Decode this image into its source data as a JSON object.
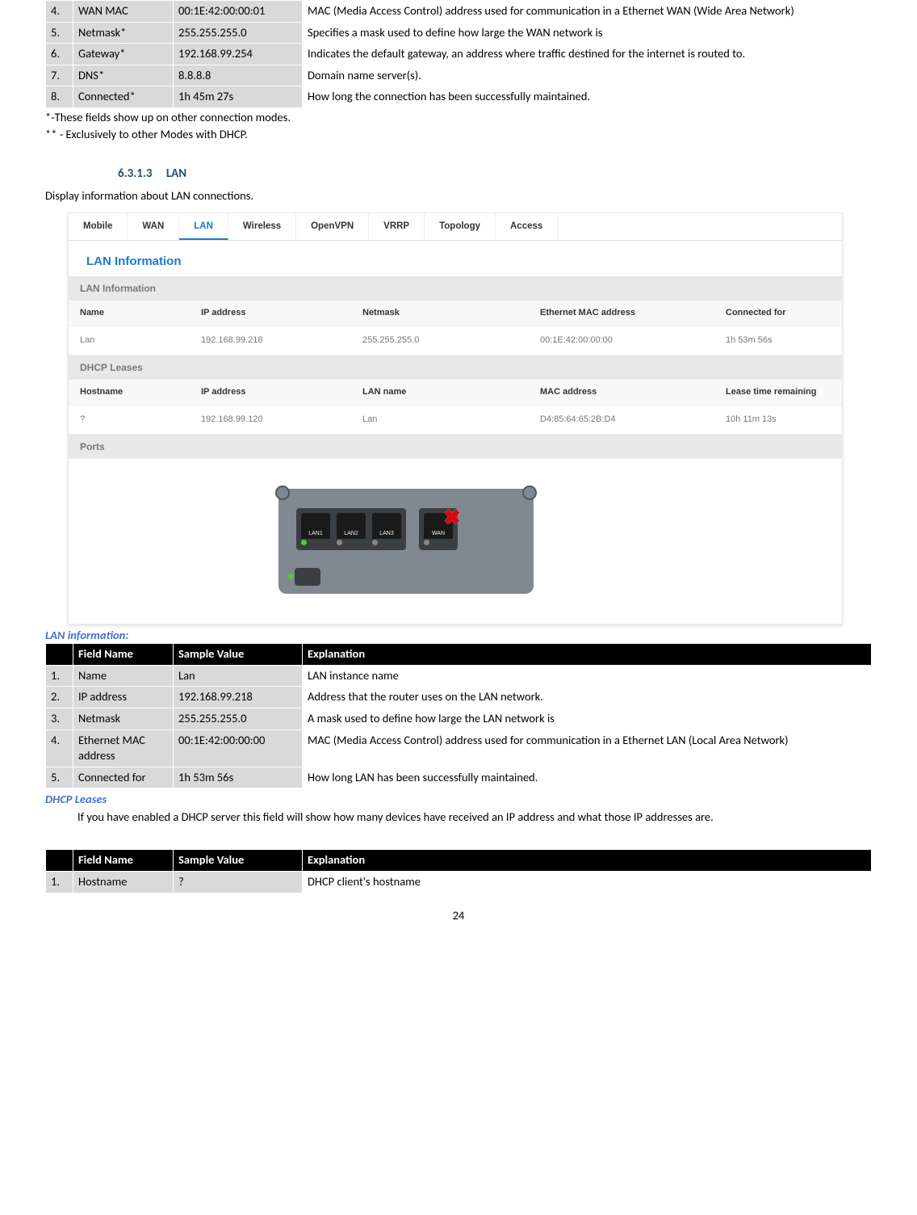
{
  "top_table": {
    "rows": [
      {
        "n": "4.",
        "field": "WAN MAC",
        "sample": "00:1E:42:00:00:01",
        "expl": "MAC (Media Access Control) address used for communication in a Ethernet WAN (Wide Area Network)"
      },
      {
        "n": "5.",
        "field": "Netmask*",
        "sample": "255.255.255.0",
        "expl": "Specifies a mask used to define how large the WAN network is"
      },
      {
        "n": "6.",
        "field": "Gateway*",
        "sample": "192.168.99.254",
        "expl": "Indicates the default gateway, an address where traffic destined for the internet is routed to."
      },
      {
        "n": "7.",
        "field": "DNS*",
        "sample": "8.8.8.8",
        "expl": "Domain name server(s)."
      },
      {
        "n": "8.",
        "field": "Connected*",
        "sample": "1h 45m 27s",
        "expl": "How long the connection has been successfully maintained."
      }
    ]
  },
  "notes": {
    "n1": "*-These fields show up on other connection modes.",
    "n2": "** - Exclusively to other Modes with DHCP."
  },
  "section": {
    "num": "6.3.1.3",
    "title": "LAN"
  },
  "intro": "Display information about LAN connections.",
  "screenshot": {
    "tabs": [
      "Mobile",
      "WAN",
      "LAN",
      "Wireless",
      "OpenVPN",
      "VRRP",
      "Topology",
      "Access"
    ],
    "active_tab": "LAN",
    "title": "LAN Information",
    "sec1": {
      "bar": "LAN Information",
      "head": [
        "Name",
        "IP address",
        "Netmask",
        "Ethernet MAC address",
        "Connected for"
      ],
      "row": [
        "Lan",
        "192.168.99.218",
        "255.255.255.0",
        "00:1E:42:00:00:00",
        "1h 53m 56s"
      ]
    },
    "sec2": {
      "bar": "DHCP Leases",
      "head": [
        "Hostname",
        "IP address",
        "LAN name",
        "MAC address",
        "Lease time remaining"
      ],
      "row": [
        "?",
        "192.168.99.120",
        "Lan",
        "D4:85:64:65:2B:D4",
        "10h 11m 13s"
      ]
    },
    "sec3": {
      "bar": "Ports"
    },
    "port_labels": [
      "LAN1",
      "LAN2",
      "LAN3",
      "WAN"
    ]
  },
  "lan_info_head": "LAN information:",
  "lan_table": {
    "headers": [
      "",
      "Field Name",
      "Sample Value",
      "Explanation"
    ],
    "rows": [
      {
        "n": "1.",
        "field": "Name",
        "sample": "Lan",
        "expl": "LAN instance name"
      },
      {
        "n": "2.",
        "field": "IP address",
        "sample": "192.168.99.218",
        "expl": "Address that the router uses on the LAN network."
      },
      {
        "n": "3.",
        "field": "Netmask",
        "sample": "255.255.255.0",
        "expl": "A mask used to define how large the LAN network is"
      },
      {
        "n": "4.",
        "field": "Ethernet MAC address",
        "sample": "00:1E:42:00:00:00",
        "expl": "MAC (Media Access Control) address used for communication in a Ethernet LAN  (Local  Area Network)"
      },
      {
        "n": "5.",
        "field": "Connected for",
        "sample": "1h 53m 56s",
        "expl": "How long LAN has been successfully maintained."
      }
    ]
  },
  "dhcp_head": "DHCP Leases",
  "dhcp_text": "If you have enabled a DHCP server this field will show how many devices have received an IP address and what those IP addresses are.",
  "dhcp_table": {
    "headers": [
      "",
      "Field Name",
      "Sample Value",
      "Explanation"
    ],
    "rows": [
      {
        "n": "1.",
        "field": "Hostname",
        "sample": "?",
        "expl": "DHCP client's hostname"
      }
    ]
  },
  "page_num": "24"
}
